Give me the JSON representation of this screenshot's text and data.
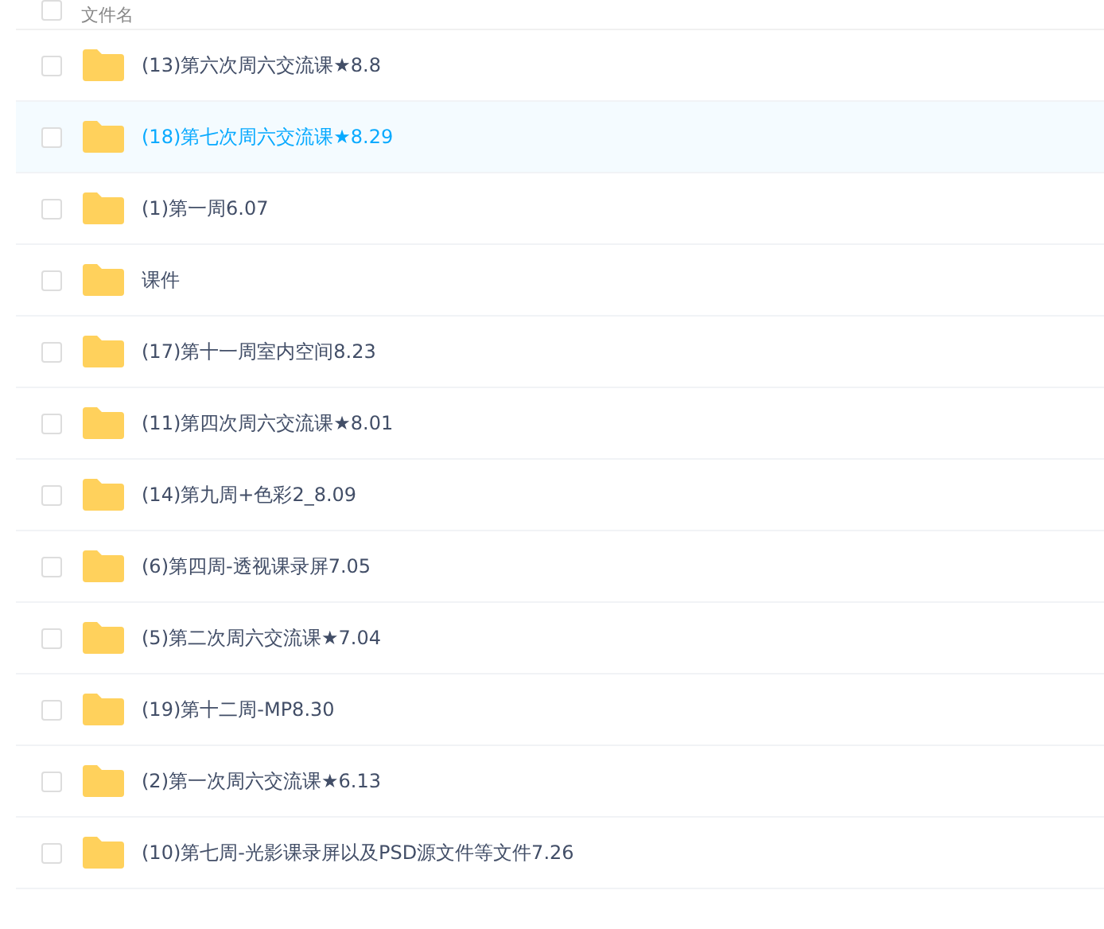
{
  "header": {
    "checked": false,
    "label": "文件名"
  },
  "rows": [
    {
      "name": "(13)第六次周六交流课★8.8",
      "checked": false,
      "highlighted": false
    },
    {
      "name": "(18)第七次周六交流课★8.29",
      "checked": false,
      "highlighted": true
    },
    {
      "name": "(1)第一周6.07",
      "checked": false,
      "highlighted": false
    },
    {
      "name": "课件",
      "checked": false,
      "highlighted": false
    },
    {
      "name": "(17)第十一周室内空间8.23",
      "checked": false,
      "highlighted": false
    },
    {
      "name": "(11)第四次周六交流课★8.01",
      "checked": false,
      "highlighted": false
    },
    {
      "name": "(14)第九周+色彩2_8.09",
      "checked": false,
      "highlighted": false
    },
    {
      "name": "(6)第四周-透视课录屏7.05",
      "checked": false,
      "highlighted": false
    },
    {
      "name": "(5)第二次周六交流课★7.04",
      "checked": false,
      "highlighted": false
    },
    {
      "name": "(19)第十二周-MP8.30",
      "checked": false,
      "highlighted": false
    },
    {
      "name": "(2)第一次周六交流课★6.13",
      "checked": false,
      "highlighted": false
    },
    {
      "name": "(10)第七周-光影课录屏以及PSD源文件等文件7.26",
      "checked": false,
      "highlighted": false
    }
  ]
}
